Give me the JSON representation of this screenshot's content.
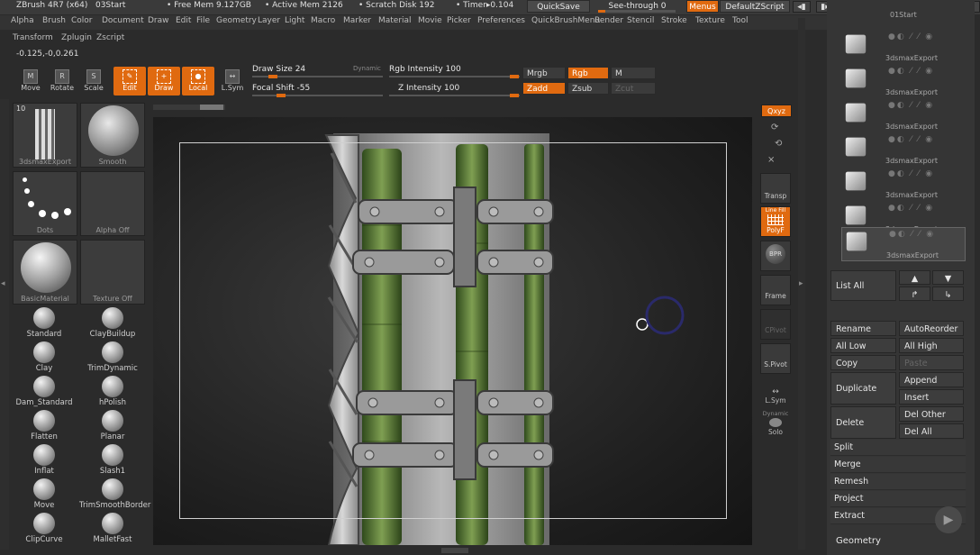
{
  "titlebar": {
    "app_title": "ZBrush 4R7 (x64)",
    "doc_name": "03Start",
    "free_mem": "• Free Mem 9.127GB",
    "active_mem": "• Active Mem 2126",
    "scratch": "• Scratch Disk 192",
    "timer": "• Timer▸0.104",
    "quicksave": "QuickSave",
    "see_through": "See-through  0",
    "see_through_value": 0,
    "menus": "Menus",
    "default_script": "DefaultZScript"
  },
  "menu": [
    "Alpha",
    "Brush",
    "Color",
    "Document",
    "Draw",
    "Edit",
    "File",
    "Geometry",
    "Layer",
    "Light",
    "Macro",
    "Marker",
    "Material",
    "Movie",
    "Picker",
    "Preferences",
    "QuickBrushMenu",
    "Render",
    "Stencil",
    "Stroke",
    "Texture",
    "Tool"
  ],
  "menu2": [
    "Transform",
    "Zplugin",
    "Zscript"
  ],
  "coords": "-0.125,-0,0.261",
  "tools": [
    {
      "label": "Move",
      "icon": "move-icon",
      "glyph": "M",
      "active": false
    },
    {
      "label": "Rotate",
      "icon": "rotate-icon",
      "glyph": "R",
      "active": false
    },
    {
      "label": "Scale",
      "icon": "scale-icon",
      "glyph": "S",
      "active": false
    },
    {
      "label": "Edit",
      "icon": "edit-icon",
      "glyph": "✎",
      "active": true
    },
    {
      "label": "Draw",
      "icon": "draw-icon",
      "glyph": "+",
      "active": true
    },
    {
      "label": "Local",
      "icon": "local-icon",
      "glyph": "●",
      "active": true
    },
    {
      "label": "L.Sym",
      "icon": "lsym-icon",
      "glyph": "↔",
      "active": false
    }
  ],
  "sliders": {
    "draw_size": "Draw Size 24",
    "dynamic": "Dynamic",
    "focal_shift": "Focal Shift -55",
    "rgb_intensity": "Rgb Intensity 100",
    "z_intensity": "Z Intensity 100"
  },
  "mode_buttons": {
    "mrgb": "Mrgb",
    "rgb": "Rgb",
    "m": "M",
    "zadd": "Zadd",
    "zsub": "Zsub",
    "zcut": "Zcut"
  },
  "left_panel": {
    "brush_count": "10",
    "current_tool": "3dsmaxExport",
    "smooth": "Smooth",
    "dots": "Dots",
    "alpha": "Alpha Off",
    "material": "BasicMaterial",
    "texture": "Texture Off"
  },
  "brushes": [
    "Standard",
    "ClayBuildup",
    "Clay",
    "TrimDynamic",
    "Dam_Standard",
    "hPolish",
    "Flatten",
    "Planar",
    "Inflat",
    "Slash1",
    "Move",
    "TrimSmoothBorder",
    "ClipCurve",
    "MalletFast"
  ],
  "right_bar": {
    "xyz": "Qxyz",
    "transp": "Transp",
    "polyf": "PolyF",
    "polyf_top": "Line Fill",
    "bpr": "BPR",
    "frame": "Frame",
    "cpivot": "CPivot",
    "spivot": "S.Pivot",
    "lsym": "L.Sym",
    "dynamic": "Dynamic",
    "solo": "Solo"
  },
  "subtool": {
    "top_name": "01Start",
    "items": [
      "3dsmaxExport",
      "3dsmaxExport",
      "3dsmaxExport",
      "3dsmaxExport",
      "3dsmaxExport",
      "3dsmaxExport",
      "3dsmaxExport"
    ]
  },
  "panel_buttons": {
    "list_all": "List All",
    "rename": "Rename",
    "auto_reorder": "AutoReorder",
    "all_low": "All Low",
    "all_high": "All High",
    "copy": "Copy",
    "paste": "Paste",
    "duplicate": "Duplicate",
    "append": "Append",
    "insert": "Insert",
    "delete": "Delete",
    "del_other": "Del Other",
    "del_all": "Del All"
  },
  "panel_rows": [
    "Split",
    "Merge",
    "Remesh",
    "Project",
    "Extract"
  ],
  "geometry_header": "Geometry",
  "colors": {
    "accent": "#e06a10",
    "background": "#2b2b2b",
    "panel": "#353535"
  }
}
